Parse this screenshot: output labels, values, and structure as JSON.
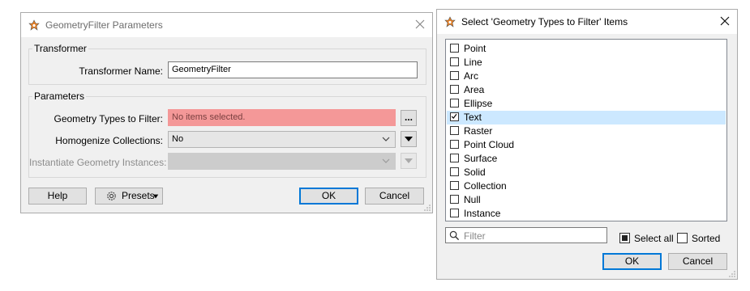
{
  "params_dialog": {
    "title": "GeometryFilter Parameters",
    "transformer_group": "Transformer",
    "transformer_name_label": "Transformer Name:",
    "transformer_name_value": "GeometryFilter",
    "parameters_group": "Parameters",
    "geometry_types_label": "Geometry Types to Filter:",
    "geometry_types_value": "No items selected.",
    "ellipsis_label": "...",
    "homogenize_label": "Homogenize Collections:",
    "homogenize_value": "No",
    "instantiate_label": "Instantiate Geometry Instances:",
    "instantiate_value": "",
    "help_label": "Help",
    "presets_label": "Presets",
    "ok_label": "OK",
    "cancel_label": "Cancel"
  },
  "select_dialog": {
    "title": "Select 'Geometry Types to Filter' Items",
    "items": [
      {
        "label": "Point",
        "checked": false
      },
      {
        "label": "Line",
        "checked": false
      },
      {
        "label": "Arc",
        "checked": false
      },
      {
        "label": "Area",
        "checked": false
      },
      {
        "label": "Ellipse",
        "checked": false
      },
      {
        "label": "Text",
        "checked": true
      },
      {
        "label": "Raster",
        "checked": false
      },
      {
        "label": "Point Cloud",
        "checked": false
      },
      {
        "label": "Surface",
        "checked": false
      },
      {
        "label": "Solid",
        "checked": false
      },
      {
        "label": "Collection",
        "checked": false
      },
      {
        "label": "Null",
        "checked": false
      },
      {
        "label": "Instance",
        "checked": false
      }
    ],
    "selected_item": "Text",
    "filter_placeholder": "Filter",
    "select_all_label": "Select all",
    "select_all_state": "indeterminate",
    "sorted_label": "Sorted",
    "sorted_checked": false,
    "ok_label": "OK",
    "cancel_label": "Cancel"
  },
  "colors": {
    "error_field": "#f49898",
    "selection": "#cce8ff",
    "primary_border": "#0078d7"
  }
}
